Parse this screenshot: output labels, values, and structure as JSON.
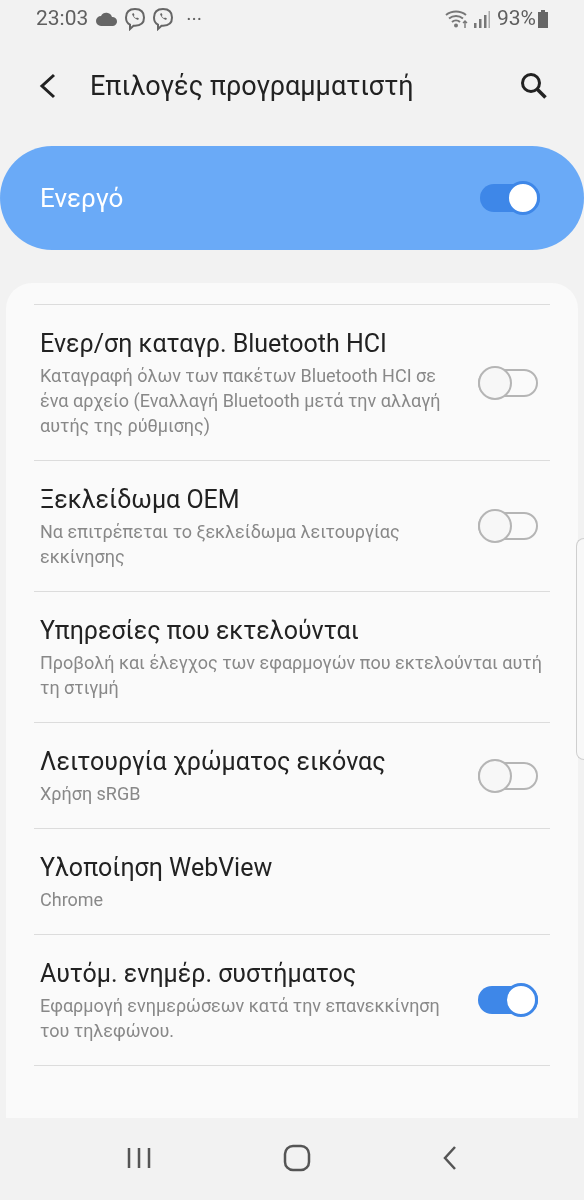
{
  "status_bar": {
    "time": "23:03",
    "more": "···",
    "battery": "93%"
  },
  "header": {
    "title": "Επιλογές προγραμματιστή"
  },
  "master": {
    "label": "Ενεργό",
    "on": true
  },
  "items": [
    {
      "kind": "toggle",
      "title": "Ενερ/ση καταγρ. Bluetooth HCI",
      "subtitle": "Καταγραφή όλων των πακέτων Bluetooth HCI σε ένα αρχείο (Εναλλαγή Bluetooth μετά την αλλαγή αυτής της ρύθμισης)",
      "on": false
    },
    {
      "kind": "toggle",
      "title": "Ξεκλείδωμα OEM",
      "subtitle": "Να επιτρέπεται το ξεκλείδωμα λειτουργίας εκκίνησης",
      "on": false
    },
    {
      "kind": "plain",
      "title": "Υπηρεσίες που εκτελούνται",
      "subtitle": "Προβολή και έλεγχος των εφαρμογών που εκτελούνται αυτή τη στιγμή"
    },
    {
      "kind": "toggle",
      "title": "Λειτουργία χρώματος εικόνας",
      "subtitle": "Χρήση sRGB",
      "on": false
    },
    {
      "kind": "plain",
      "title": "Υλοποίηση WebView",
      "subtitle": "Chrome"
    },
    {
      "kind": "toggle",
      "title": "Αυτόμ. ενημέρ. συστήματος",
      "subtitle": "Εφαρμογή ενημερώσεων κατά την επανεκκίνηση του τηλεφώνου.",
      "on": true
    }
  ]
}
